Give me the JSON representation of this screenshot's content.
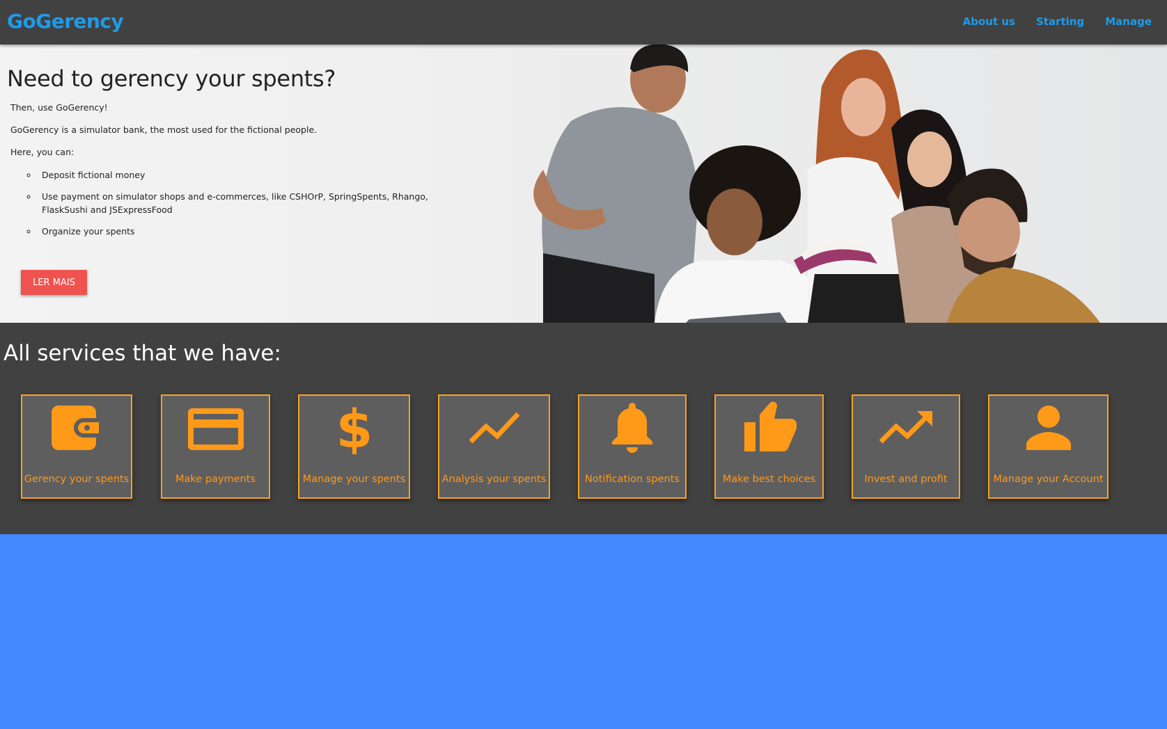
{
  "navbar": {
    "brand": "GoGerency",
    "links": [
      "About us",
      "Starting",
      "Manage"
    ]
  },
  "hero": {
    "title": "Need to gerency your spents?",
    "p1": "Then, use GoGerency!",
    "p2": "GoGerency is a simulator bank, the most used for the fictional people.",
    "p3": "Here, you can:",
    "list": [
      "Deposit fictional money",
      "Use payment on simulator shops and e-commerces, like CSHOrP, SpringSpents, Rhango, FlaskSushi and JSExpressFood",
      "Organize your spents"
    ],
    "cta": "LER MAIS"
  },
  "services": {
    "title": "All services that we have:",
    "cards": [
      {
        "label": "Gerency your spents",
        "icon": "wallet-icon"
      },
      {
        "label": "Make payments",
        "icon": "credit-card-icon"
      },
      {
        "label": "Manage your spents",
        "icon": "dollar-icon"
      },
      {
        "label": "Analysis your spents",
        "icon": "line-chart-icon"
      },
      {
        "label": "Notification spents",
        "icon": "bell-icon"
      },
      {
        "label": "Make best choices",
        "icon": "thumb-up-icon"
      },
      {
        "label": "Invest and profit",
        "icon": "trending-up-icon"
      },
      {
        "label": "Manage your Account",
        "icon": "person-icon"
      }
    ]
  },
  "colors": {
    "navbar": "#414141",
    "brand": "#1e9be9",
    "cta": "#ef5350",
    "services_bg": "#414141",
    "card_bg": "#5e5e5e",
    "accent": "#ff9a19",
    "footer_bg": "#4488ff"
  }
}
